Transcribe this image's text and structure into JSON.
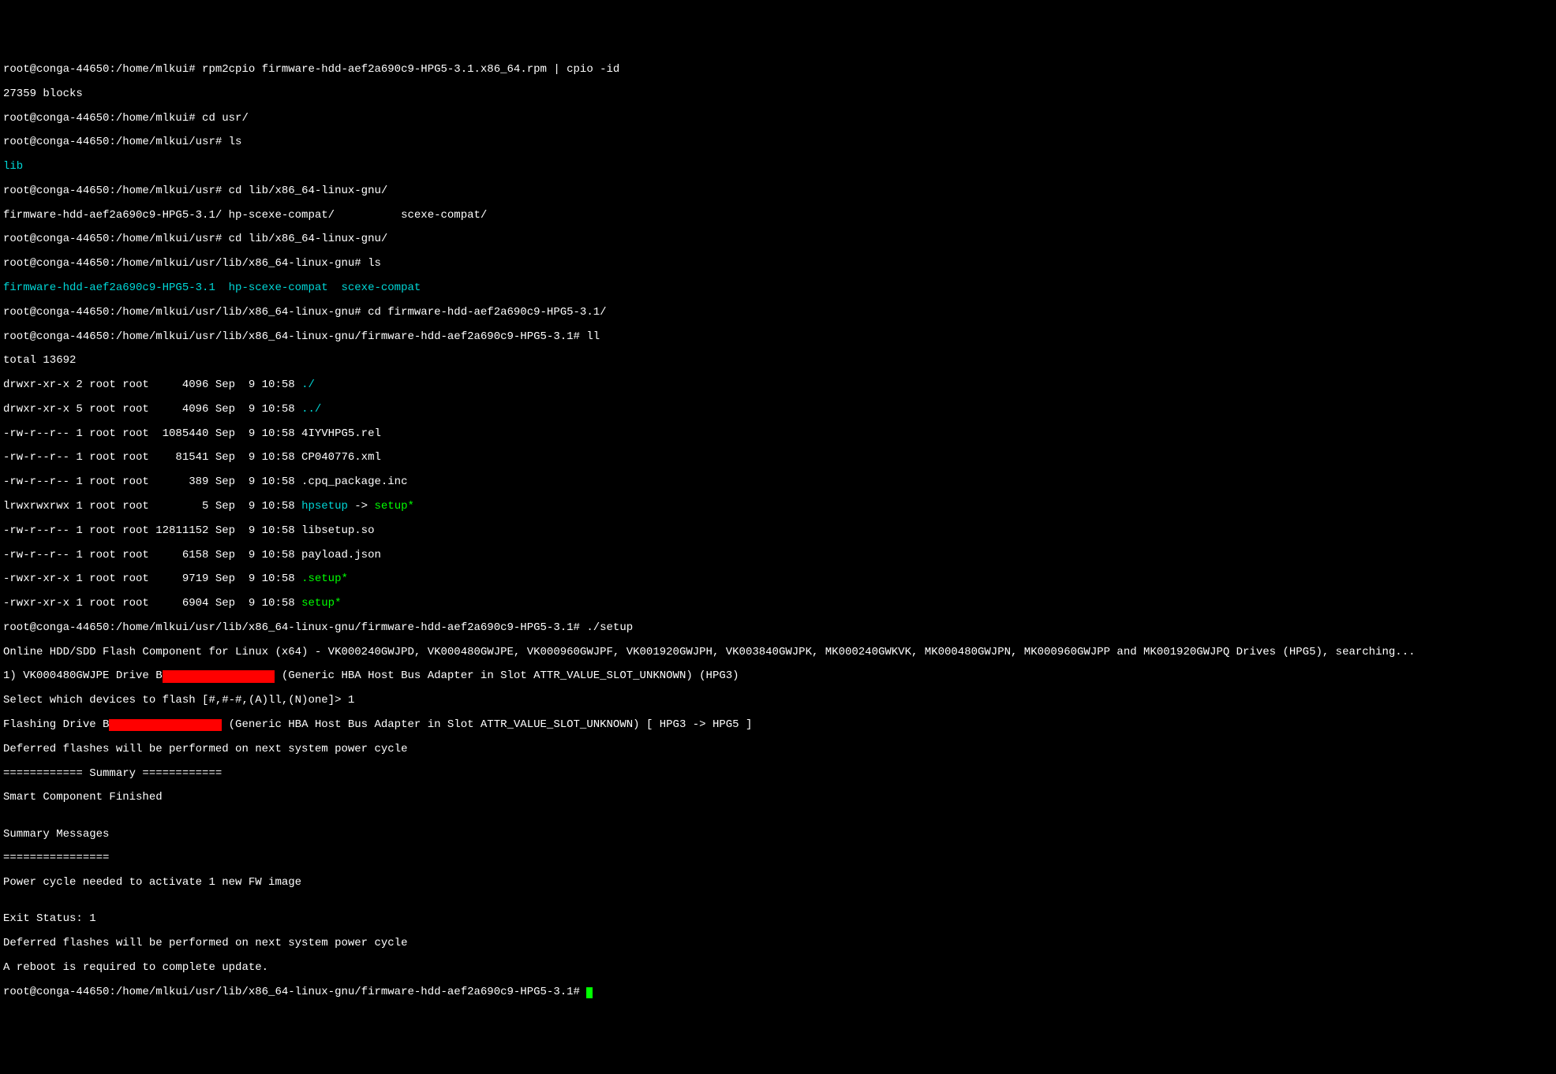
{
  "lines": {
    "l01_prompt": "root@conga-44650:/home/mlkui# ",
    "l01_cmd": "rpm2cpio firmware-hdd-aef2a690c9-HPG5-3.1.x86_64.rpm | cpio -id",
    "l02": "27359 blocks",
    "l03_prompt": "root@conga-44650:/home/mlkui# ",
    "l03_cmd": "cd usr/",
    "l04_prompt": "root@conga-44650:/home/mlkui/usr# ",
    "l04_cmd": "ls",
    "l05_lib": "lib",
    "l06_prompt": "root@conga-44650:/home/mlkui/usr# ",
    "l06_cmd": "cd lib/x86_64-linux-gnu/",
    "l07": "firmware-hdd-aef2a690c9-HPG5-3.1/ hp-scexe-compat/          scexe-compat/",
    "l08_prompt": "root@conga-44650:/home/mlkui/usr# ",
    "l08_cmd": "cd lib/x86_64-linux-gnu/",
    "l09_prompt": "root@conga-44650:/home/mlkui/usr/lib/x86_64-linux-gnu# ",
    "l09_cmd": "ls",
    "l10_a": "firmware-hdd-aef2a690c9-HPG5-3.1",
    "l10_b": "  hp-scexe-compat",
    "l10_c": "  scexe-compat",
    "l11_prompt": "root@conga-44650:/home/mlkui/usr/lib/x86_64-linux-gnu# ",
    "l11_cmd": "cd firmware-hdd-aef2a690c9-HPG5-3.1/",
    "l12_prompt": "root@conga-44650:/home/mlkui/usr/lib/x86_64-linux-gnu/firmware-hdd-aef2a690c9-HPG5-3.1# ",
    "l12_cmd": "ll",
    "l13": "total 13692",
    "l14_a": "drwxr-xr-x 2 root root     4096 Sep  9 10:58 ",
    "l14_b": "./",
    "l15_a": "drwxr-xr-x 5 root root     4096 Sep  9 10:58 ",
    "l15_b": "../",
    "l16": "-rw-r--r-- 1 root root  1085440 Sep  9 10:58 4IYVHPG5.rel",
    "l17": "-rw-r--r-- 1 root root    81541 Sep  9 10:58 CP040776.xml",
    "l18": "-rw-r--r-- 1 root root      389 Sep  9 10:58 .cpq_package.inc",
    "l19_a": "lrwxrwxrwx 1 root root        5 Sep  9 10:58 ",
    "l19_b": "hpsetup",
    "l19_c": " -> ",
    "l19_d": "setup*",
    "l20": "-rw-r--r-- 1 root root 12811152 Sep  9 10:58 libsetup.so",
    "l21": "-rw-r--r-- 1 root root     6158 Sep  9 10:58 payload.json",
    "l22_a": "-rwxr-xr-x 1 root root     9719 Sep  9 10:58 ",
    "l22_b": ".setup*",
    "l23_a": "-rwxr-xr-x 1 root root     6904 Sep  9 10:58 ",
    "l23_b": "setup*",
    "l24_prompt": "root@conga-44650:/home/mlkui/usr/lib/x86_64-linux-gnu/firmware-hdd-aef2a690c9-HPG5-3.1# ",
    "l24_cmd": "./setup",
    "l25": "Online HDD/SDD Flash Component for Linux (x64) - VK000240GWJPD, VK000480GWJPE, VK000960GWJPF, VK001920GWJPH, VK003840GWJPK, MK000240GWKVK, MK000480GWJPN, MK000960GWJPP and MK001920GWJPQ Drives (HPG5), searching...",
    "l26_a": "1) VK000480GWJPE Drive B",
    "l26_redacted": "XXXXXXXXXXXXXXXXX",
    "l26_b": " (Generic HBA Host Bus Adapter in Slot ATTR_VALUE_SLOT_UNKNOWN) (HPG3)",
    "l27": "Select which devices to flash [#,#-#,(A)ll,(N)one]> 1",
    "l28_a": "Flashing Drive B",
    "l28_redacted": "XXXXXXXXXXXXXXXXX",
    "l28_b": " (Generic HBA Host Bus Adapter in Slot ATTR_VALUE_SLOT_UNKNOWN) [ HPG3 -> HPG5 ]",
    "l29": "Deferred flashes will be performed on next system power cycle",
    "l30": "============ Summary ============",
    "l31": "Smart Component Finished",
    "l32": "",
    "l33": "Summary Messages",
    "l34": "================",
    "l35": "Power cycle needed to activate 1 new FW image",
    "l36": "",
    "l37": "Exit Status: 1",
    "l38": "Deferred flashes will be performed on next system power cycle",
    "l39": "A reboot is required to complete update.",
    "l40_prompt": "root@conga-44650:/home/mlkui/usr/lib/x86_64-linux-gnu/firmware-hdd-aef2a690c9-HPG5-3.1# "
  }
}
